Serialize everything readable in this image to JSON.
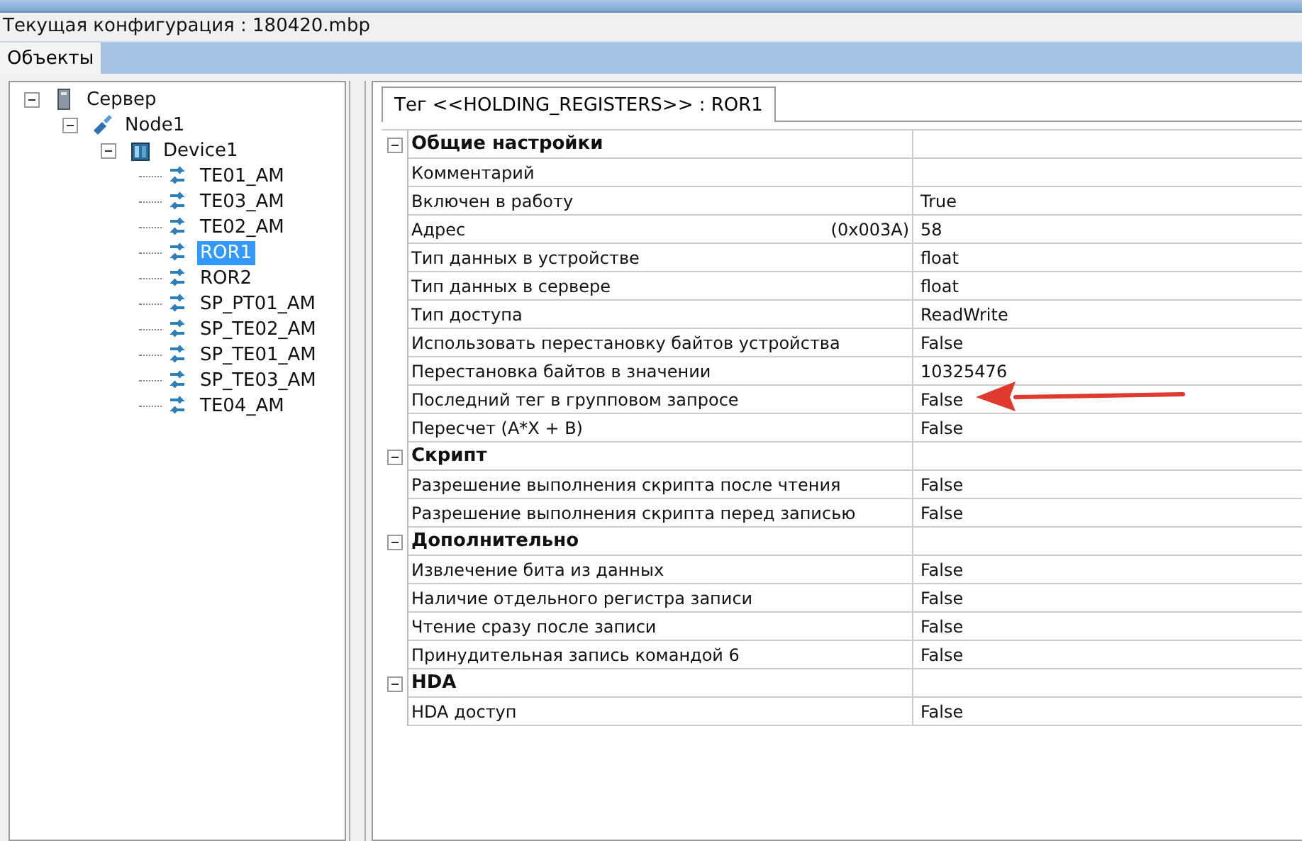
{
  "title": "Текущая конфигурация : 180420.mbp",
  "tabs": [
    {
      "label": "Объекты",
      "selected": true
    }
  ],
  "tree": [
    {
      "label": "Сервер",
      "kind": "server",
      "expanded": true,
      "selected": false,
      "children": [
        {
          "label": "Node1",
          "kind": "node",
          "expanded": true,
          "selected": false,
          "children": [
            {
              "label": "Device1",
              "kind": "device",
              "expanded": true,
              "selected": false,
              "children": [
                {
                  "label": "TE01_AM",
                  "kind": "tag",
                  "selected": false
                },
                {
                  "label": "TE03_AM",
                  "kind": "tag",
                  "selected": false
                },
                {
                  "label": "TE02_AM",
                  "kind": "tag",
                  "selected": false
                },
                {
                  "label": "ROR1",
                  "kind": "tag",
                  "selected": true
                },
                {
                  "label": "ROR2",
                  "kind": "tag",
                  "selected": false
                },
                {
                  "label": "SP_PT01_AM",
                  "kind": "tag",
                  "selected": false
                },
                {
                  "label": "SP_TE02_AM",
                  "kind": "tag",
                  "selected": false
                },
                {
                  "label": "SP_TE01_AM",
                  "kind": "tag",
                  "selected": false
                },
                {
                  "label": "SP_TE03_AM",
                  "kind": "tag",
                  "selected": false
                },
                {
                  "label": "TE04_AM",
                  "kind": "tag",
                  "selected": false
                }
              ]
            }
          ]
        }
      ]
    }
  ],
  "detail_tab": {
    "label": "Тег  <<HOLDING_REGISTERS>> : ROR1",
    "selected": true
  },
  "sections": [
    {
      "title": "Общие настройки",
      "expanded": true,
      "rows": [
        {
          "name": "Комментарий"
        },
        {
          "name": "Включен в работу",
          "value": "True"
        },
        {
          "name": "Адрес",
          "hex": "(0x003A)",
          "value": "58"
        },
        {
          "name": "Тип данных в устройстве",
          "value": "float"
        },
        {
          "name": "Тип данных в сервере",
          "value": "float"
        },
        {
          "name": "Тип доступа",
          "value": "ReadWrite"
        },
        {
          "name": "Использовать перестановку байтов устройства",
          "value": "False"
        },
        {
          "name": "Перестановка байтов в значении",
          "value": "10325476"
        },
        {
          "name": "Последний тег в групповом запросе",
          "value": "False"
        },
        {
          "name": "Пересчет (A*X + B)",
          "value": "False"
        }
      ]
    },
    {
      "title": "Скрипт",
      "expanded": true,
      "rows": [
        {
          "name": "Разрешение выполнения скрипта после чтения",
          "value": "False"
        },
        {
          "name": "Разрешение выполнения скрипта перед записью",
          "value": "False"
        }
      ]
    },
    {
      "title": "Дополнительно",
      "expanded": true,
      "rows": [
        {
          "name": "Извлечение бита из данных",
          "value": "False"
        },
        {
          "name": "Наличие отдельного регистра записи",
          "value": "False"
        },
        {
          "name": "Чтение сразу после записи",
          "value": "False"
        },
        {
          "name": "Принудительная запись командой 6",
          "value": "False"
        }
      ]
    },
    {
      "title": "HDA",
      "expanded": true,
      "rows": [
        {
          "name": "HDA доступ",
          "value": "False"
        }
      ]
    }
  ]
}
